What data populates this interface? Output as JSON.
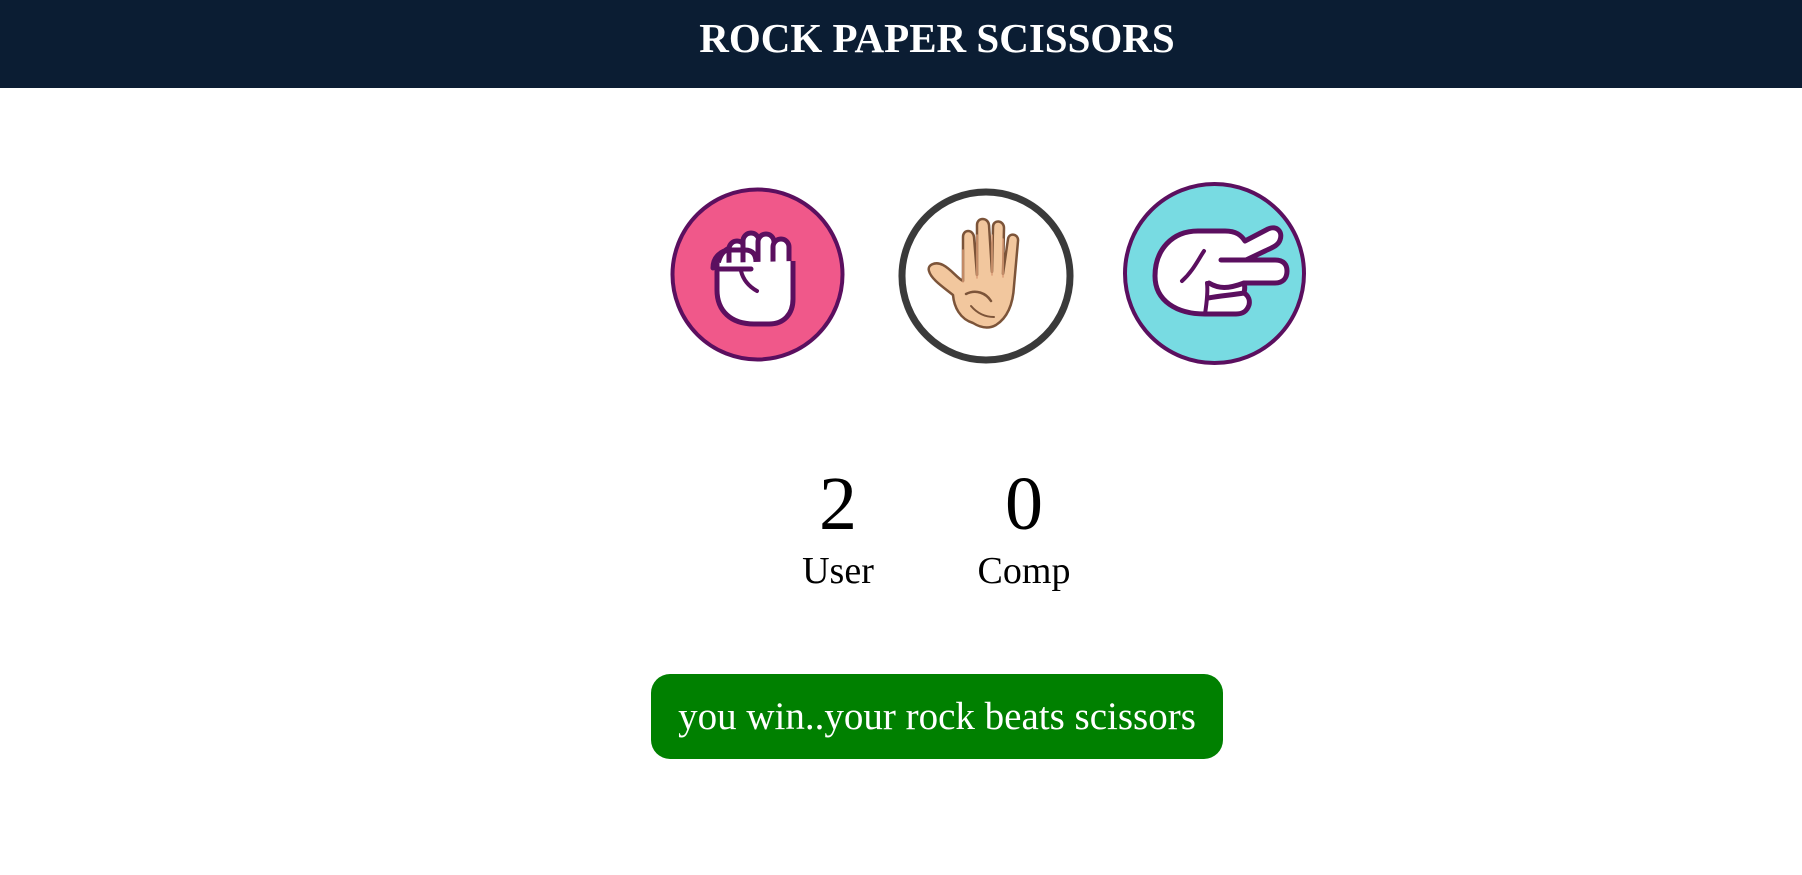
{
  "header": {
    "title": "ROCK PAPER SCISSORS",
    "background": "#0b1d33"
  },
  "choices": [
    {
      "name": "rock",
      "icon": "rock-fist-icon",
      "fill": "#f0588a",
      "border": "#5b0f5f"
    },
    {
      "name": "paper",
      "icon": "paper-hand-icon",
      "fill": "#ffffff",
      "border": "#3a3a3a",
      "skin": "#f2c79e"
    },
    {
      "name": "scissors",
      "icon": "scissors-hand-icon",
      "fill": "#78dbe2",
      "border": "#5b0f5f"
    }
  ],
  "scoreboard": {
    "user": {
      "score": "2",
      "label": "User"
    },
    "comp": {
      "score": "0",
      "label": "Comp"
    }
  },
  "message": {
    "text": "you win..your rock beats scissors",
    "background": "#008000"
  }
}
